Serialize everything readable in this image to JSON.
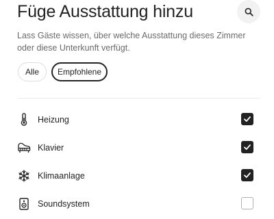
{
  "header": {
    "title": "Füge Ausstattung hinzu",
    "search_icon": "search-icon"
  },
  "subtitle": "Lass Gäste wissen, über welche Ausstattung dieses Zimmer oder diese Unterkunft verfügt.",
  "filters": {
    "all_label": "Alle",
    "recommended_label": "Empfohlene",
    "selected": "Empfohlene"
  },
  "amenities": [
    {
      "label": "Heizung",
      "icon": "thermometer-icon",
      "checked": true
    },
    {
      "label": "Klavier",
      "icon": "piano-icon",
      "checked": true
    },
    {
      "label": "Klimaanlage",
      "icon": "snowflake-icon",
      "checked": true
    },
    {
      "label": "Soundsystem",
      "icon": "speaker-icon",
      "checked": false
    }
  ],
  "colors": {
    "text": "#222222",
    "muted": "#6a6a6a",
    "checkbox_checked": "#222222",
    "checkbox_border": "#b0b0b0"
  }
}
